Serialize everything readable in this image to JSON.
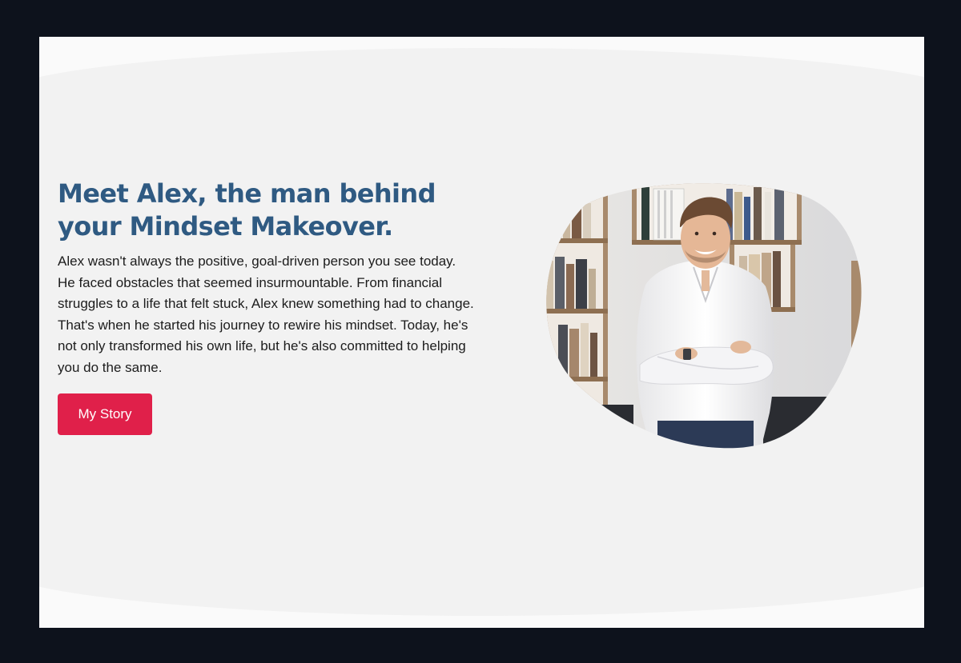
{
  "hero": {
    "headline": "Meet Alex, the man behind your Mindset Makeover.",
    "body": "Alex wasn't always the positive, goal-driven person you see today. He faced obstacles that seemed insurmountable. From financial struggles to a life that felt stuck, Alex knew something had to change. That's when he started his journey to rewire his mindset. Today, he's not only transformed his own life, but he's also committed to helping you do the same.",
    "cta_label": "My Story"
  },
  "colors": {
    "heading": "#2f5a82",
    "cta_background": "#e0204a",
    "page_background": "#0d121c",
    "section_background": "#f2f2f2"
  },
  "portrait": {
    "subject": "smiling man in white shirt with crossed arms in front of bookshelves",
    "shape": "organic blob"
  }
}
